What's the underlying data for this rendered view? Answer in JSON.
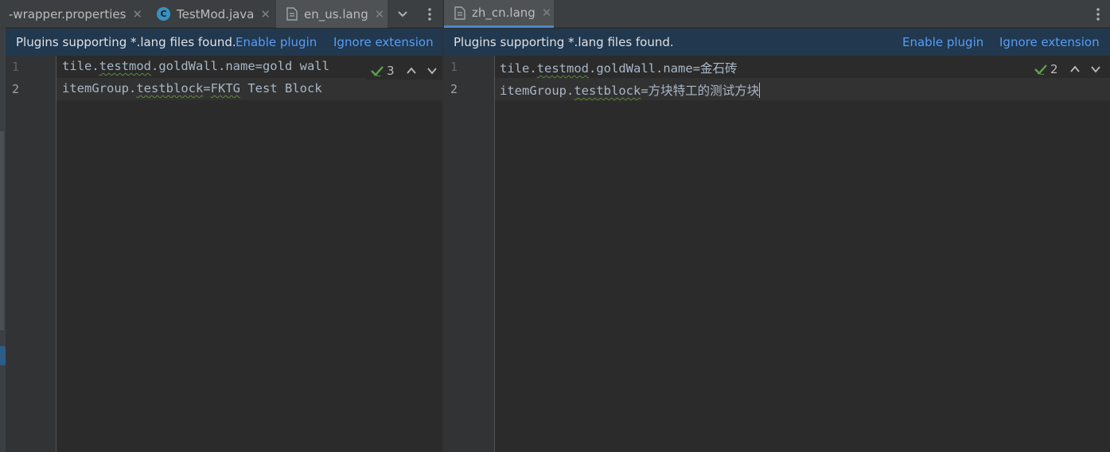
{
  "left_pane": {
    "tabs": [
      {
        "label": "-wrapper.properties"
      },
      {
        "label": "TestMod.java",
        "icon": "C"
      },
      {
        "label": "en_us.lang"
      }
    ],
    "banner": {
      "message": "Plugins supporting *.lang files found.",
      "enable_label": "Enable plugin",
      "ignore_label": "Ignore extension"
    },
    "lines": [
      {
        "number": "1",
        "prefix": "tile.",
        "w1": "testmod",
        "suffix": ".goldWall.name=gold wall"
      },
      {
        "number": "2",
        "prefix": "itemGroup.",
        "w1": "testblock",
        "mid": "=",
        "w2": "FKTG",
        "suffix": " Test Block"
      }
    ],
    "inspection_count": "3"
  },
  "right_pane": {
    "tabs": [
      {
        "label": "zh_cn.lang"
      }
    ],
    "banner": {
      "message": "Plugins supporting *.lang files found.",
      "enable_label": "Enable plugin",
      "ignore_label": "Ignore extension"
    },
    "lines": [
      {
        "number": "1",
        "prefix": "tile.",
        "w1": "testmod",
        "suffix": ".goldWall.name=金石砖"
      },
      {
        "number": "2",
        "prefix": "itemGroup.",
        "w1": "testblock",
        "suffix": "=方块特工的测试方块"
      }
    ],
    "inspection_count": "2"
  },
  "colors": {
    "banner_bg": "#21384f",
    "link": "#589df6",
    "accent": "#4a88c7",
    "inspection_ok": "#5fa04e"
  }
}
